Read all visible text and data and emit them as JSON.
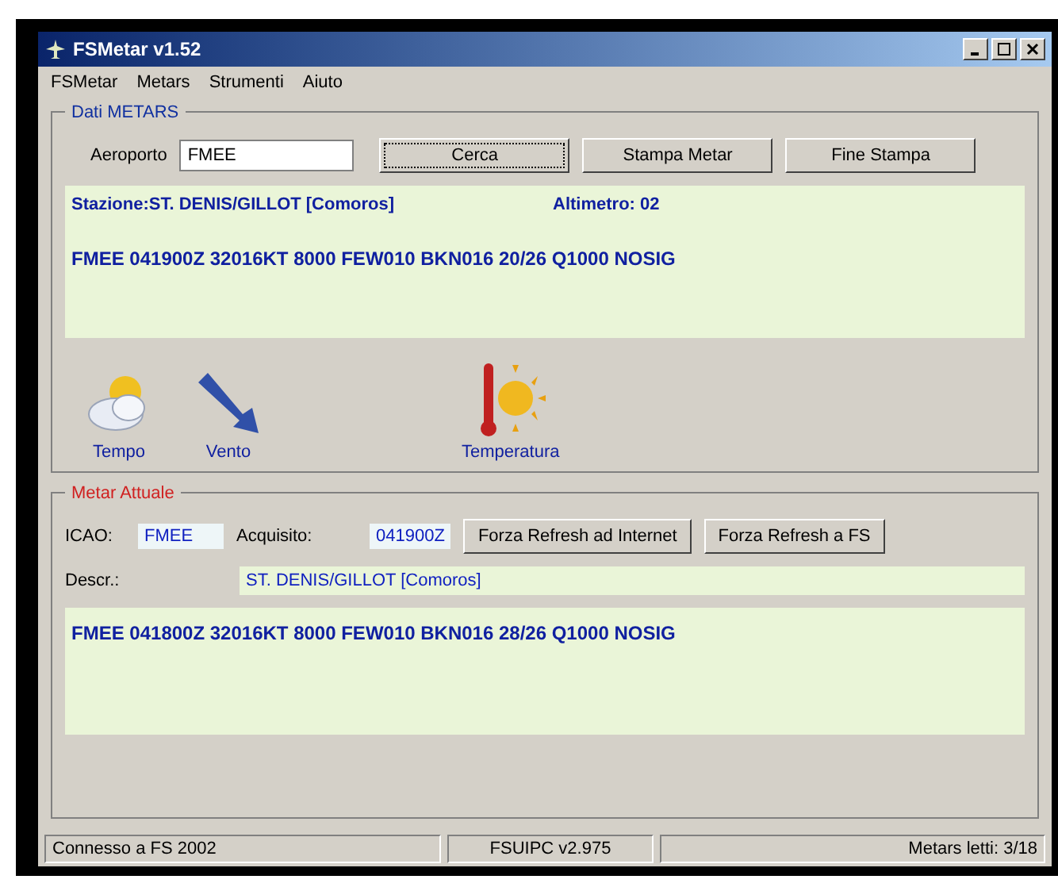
{
  "window": {
    "title": "FSMetar v1.52"
  },
  "menu": [
    "FSMetar",
    "Metars",
    "Strumenti",
    "Aiuto"
  ],
  "search_group": {
    "title": "Dati METARS",
    "airport_label": "Aeroporto",
    "airport_value": "FMEE",
    "buttons": [
      {
        "label": "Cerca",
        "focused": true
      },
      {
        "label": "Stampa Metar",
        "focused": false
      },
      {
        "label": "Fine Stampa",
        "focused": false
      }
    ],
    "station": "Stazione:ST. DENIS/GILLOT [Comoros]",
    "altimeter": "Altimetro: 02",
    "metar": "FMEE 041900Z 32016KT 8000 FEW010 BKN016 20/26 Q1000 NOSIG",
    "icons": [
      {
        "kind": "weather",
        "label": "Tempo"
      },
      {
        "kind": "wind",
        "label": "Vento"
      },
      {
        "kind": "temperature",
        "label": "Temperatura"
      }
    ]
  },
  "current_group": {
    "title": "Metar Attuale",
    "icao_label": "ICAO:",
    "icao": "FMEE",
    "acquired_label": "Acquisito:",
    "acquired": "041900Z",
    "buttons": [
      "Forza Refresh ad Internet",
      "Forza Refresh a FS"
    ],
    "descr_label": "Descr.:",
    "descr": "ST. DENIS/GILLOT [Comoros]",
    "metar": "FMEE 041800Z 32016KT 8000 FEW010 BKN016 28/26 Q1000 NOSIG"
  },
  "status_bar": [
    "Connesso a FS 2002",
    "FSUIPC v2.975",
    "Metars letti: 3/18"
  ]
}
